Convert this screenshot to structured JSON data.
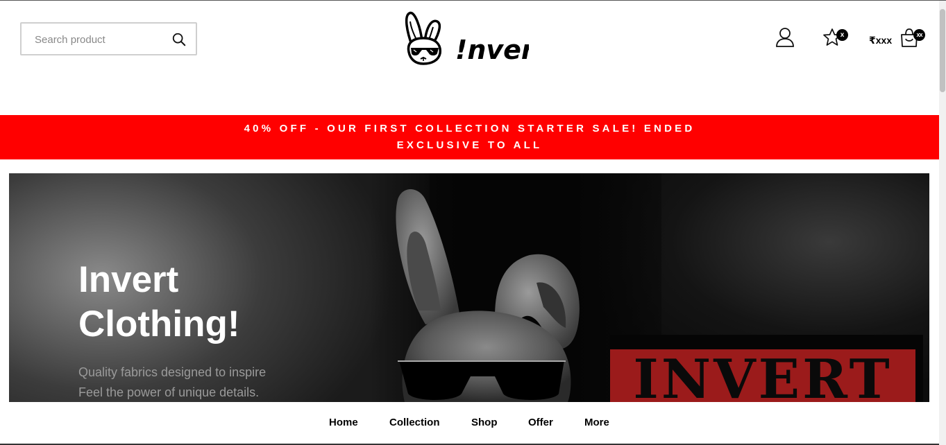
{
  "search": {
    "placeholder": "Search product",
    "icon": "search-icon"
  },
  "logo": {
    "text": "!nvert",
    "icon": "rabbit-with-sunglasses-logo"
  },
  "header_icons": {
    "account_icon": "user-icon",
    "wishlist_icon": "star-icon",
    "wishlist_count": "x",
    "cart_total": "₹xxx",
    "cart_icon": "shopping-bag-icon",
    "cart_count": "xx"
  },
  "promo": {
    "line1": "40% OFF - OUR FIRST COLLECTION STARTER SALE! ENDED",
    "line2": "EXCLUSIVE TO ALL",
    "color": "#ff0000"
  },
  "hero": {
    "title": "Invert Clothing!",
    "subtitle_line1": "Quality fabrics designed to inspire",
    "subtitle_line2": "Feel the power of unique details.",
    "stamp_text": "INVERT",
    "stamp_color": "#9b1b1b"
  },
  "nav": {
    "items": [
      "Home",
      "Collection",
      "Shop",
      "Offer",
      "More"
    ]
  }
}
